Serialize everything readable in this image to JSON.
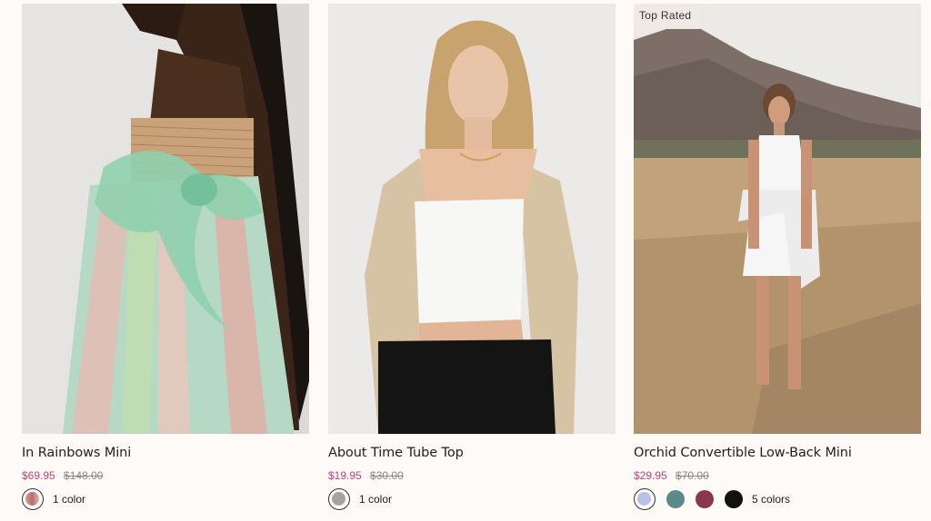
{
  "products": [
    {
      "title": "In Rainbows Mini",
      "sale_price": "$69.95",
      "original_price": "$148.00",
      "colors_label": "1 color",
      "badge": "",
      "swatches": [
        "#c78b86"
      ]
    },
    {
      "title": "About Time Tube Top",
      "sale_price": "$19.95",
      "original_price": "$30.00",
      "colors_label": "1 color",
      "badge": "",
      "swatches": [
        "#a8a49d"
      ]
    },
    {
      "title": "Orchid Convertible Low-Back Mini",
      "sale_price": "$29.95",
      "original_price": "$70.00",
      "colors_label": "5 colors",
      "badge": "Top Rated",
      "swatches": [
        "#b7c2e6",
        "#5b8a8a",
        "#8c3550",
        "#111111"
      ]
    }
  ],
  "colors": {
    "background": "#fdfaf8",
    "sale": "#c2446f",
    "badge_bg": "#efeae4"
  }
}
